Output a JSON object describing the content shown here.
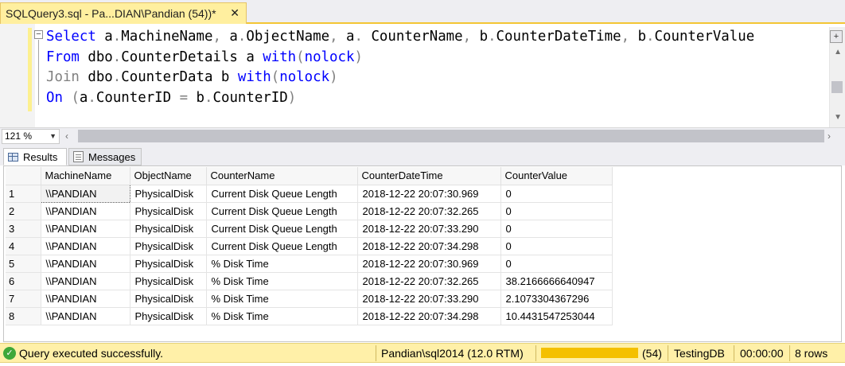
{
  "tab": {
    "title": "SQLQuery3.sql - Pa...DIAN\\Pandian (54))*",
    "close_glyph": "✕"
  },
  "editor": {
    "lines": [
      [
        [
          "kw",
          "Select"
        ],
        [
          "plain",
          " a"
        ],
        [
          "gray",
          "."
        ],
        [
          "plain",
          "MachineName"
        ],
        [
          "gray",
          ","
        ],
        [
          "plain",
          " a"
        ],
        [
          "gray",
          "."
        ],
        [
          "plain",
          "ObjectName"
        ],
        [
          "gray",
          ","
        ],
        [
          "plain",
          " a"
        ],
        [
          "gray",
          "."
        ],
        [
          "plain",
          " CounterName"
        ],
        [
          "gray",
          ","
        ],
        [
          "plain",
          " b"
        ],
        [
          "gray",
          "."
        ],
        [
          "plain",
          "CounterDateTime"
        ],
        [
          "gray",
          ","
        ],
        [
          "plain",
          " b"
        ],
        [
          "gray",
          "."
        ],
        [
          "plain",
          "CounterValue"
        ]
      ],
      [
        [
          "kw",
          "From"
        ],
        [
          "plain",
          " dbo"
        ],
        [
          "gray",
          "."
        ],
        [
          "plain",
          "CounterDetails a "
        ],
        [
          "kw",
          "with"
        ],
        [
          "gray",
          "("
        ],
        [
          "kw",
          "nolock"
        ],
        [
          "gray",
          ")"
        ]
      ],
      [
        [
          "gray",
          "Join"
        ],
        [
          "plain",
          " dbo"
        ],
        [
          "gray",
          "."
        ],
        [
          "plain",
          "CounterData b "
        ],
        [
          "kw",
          "with"
        ],
        [
          "gray",
          "("
        ],
        [
          "kw",
          "nolock"
        ],
        [
          "gray",
          ")"
        ]
      ],
      [
        [
          "kw",
          "On"
        ],
        [
          "plain",
          " "
        ],
        [
          "gray",
          "("
        ],
        [
          "plain",
          "a"
        ],
        [
          "gray",
          "."
        ],
        [
          "plain",
          "CounterID "
        ],
        [
          "gray",
          "="
        ],
        [
          "plain",
          " b"
        ],
        [
          "gray",
          "."
        ],
        [
          "plain",
          "CounterID"
        ],
        [
          "gray",
          ")"
        ]
      ]
    ]
  },
  "zoom": {
    "value": "121 %"
  },
  "result_tabs": {
    "results": "Results",
    "messages": "Messages"
  },
  "grid": {
    "columns": [
      "MachineName",
      "ObjectName",
      "CounterName",
      "CounterDateTime",
      "CounterValue"
    ],
    "rows": [
      [
        "1",
        "\\\\PANDIAN",
        "PhysicalDisk",
        "Current Disk Queue Length",
        "2018-12-22 20:07:30.969",
        "0"
      ],
      [
        "2",
        "\\\\PANDIAN",
        "PhysicalDisk",
        "Current Disk Queue Length",
        "2018-12-22 20:07:32.265",
        "0"
      ],
      [
        "3",
        "\\\\PANDIAN",
        "PhysicalDisk",
        "Current Disk Queue Length",
        "2018-12-22 20:07:33.290",
        "0"
      ],
      [
        "4",
        "\\\\PANDIAN",
        "PhysicalDisk",
        "Current Disk Queue Length",
        "2018-12-22 20:07:34.298",
        "0"
      ],
      [
        "5",
        "\\\\PANDIAN",
        "PhysicalDisk",
        "% Disk Time",
        "2018-12-22 20:07:30.969",
        "0"
      ],
      [
        "6",
        "\\\\PANDIAN",
        "PhysicalDisk",
        "% Disk Time",
        "2018-12-22 20:07:32.265",
        "38.2166666640947"
      ],
      [
        "7",
        "\\\\PANDIAN",
        "PhysicalDisk",
        "% Disk Time",
        "2018-12-22 20:07:33.290",
        "2.1073304367296"
      ],
      [
        "8",
        "\\\\PANDIAN",
        "PhysicalDisk",
        "% Disk Time",
        "2018-12-22 20:07:34.298",
        "10.4431547253044"
      ]
    ]
  },
  "status": {
    "message": "Query executed successfully.",
    "server": "Pandian\\sql2014 (12.0 RTM)",
    "spid": "(54)",
    "database": "TestingDB",
    "elapsed": "00:00:00",
    "rows": "8 rows"
  },
  "colors": {
    "accent": "#f3c534",
    "status_bg": "#fff0a8",
    "keyword": "#0000ff",
    "punct": "#808080"
  }
}
